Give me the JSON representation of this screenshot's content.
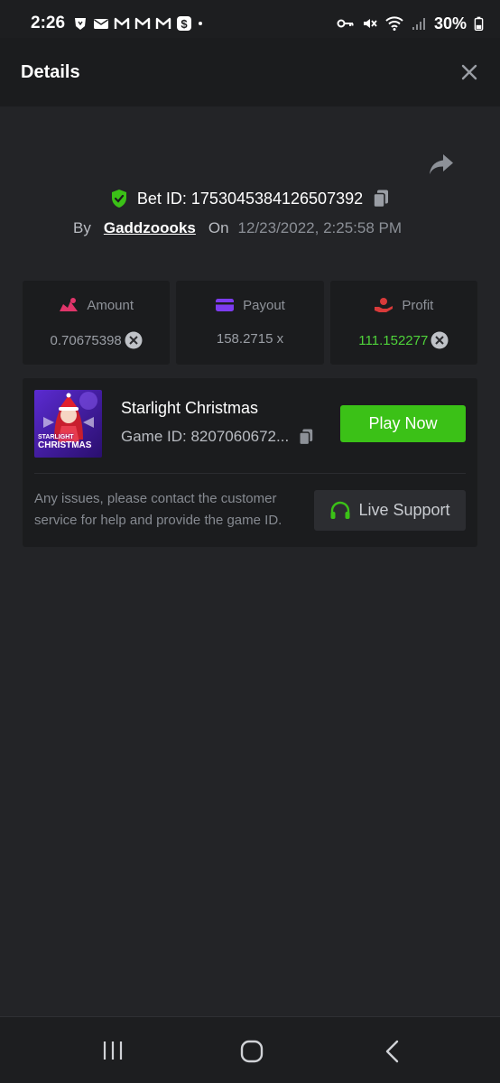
{
  "status_bar": {
    "time": "2:26",
    "battery": "30%"
  },
  "header": {
    "title": "Details"
  },
  "bet": {
    "bet_id_label": "Bet ID:",
    "bet_id": "1753045384126507392",
    "by_label": "By",
    "username": "Gaddzoooks",
    "on_label": "On",
    "date": "12/23/2022, 2:25:58 PM"
  },
  "stats": {
    "amount": {
      "label": "Amount",
      "value": "0.70675398"
    },
    "payout": {
      "label": "Payout",
      "value": "158.2715 x"
    },
    "profit": {
      "label": "Profit",
      "value": "111.152277"
    }
  },
  "game": {
    "name": "Starlight Christmas",
    "game_id": "Game ID: 8207060672...",
    "thumb_title_line1": "STARLIGHT",
    "thumb_title_line2": "CHRISTMAS",
    "play_label": "Play Now",
    "support_text": "Any issues, please contact the customer service for help and provide the game ID.",
    "support_label": "Live Support"
  },
  "colors": {
    "background": "#232427",
    "card": "#1b1c1e",
    "accent_green": "#3bc117",
    "profit_green": "#4fd33a",
    "amount_icon": "#e0356a",
    "payout_icon": "#7d3cf0",
    "profit_icon": "#d83a3a"
  },
  "icons": {
    "status_left": [
      "brave-icon",
      "mail-icon",
      "gmail-icon",
      "gmail-icon",
      "gmail-icon",
      "cashapp-icon",
      "dot-icon"
    ],
    "status_right": [
      "key-icon",
      "mute-icon",
      "wifi-icon",
      "signal-icon",
      "battery-icon"
    ],
    "close": "close-icon",
    "share": "share-icon",
    "verified": "shield-check-icon",
    "copy": "copy-icon",
    "amount": "bet-amount-icon",
    "payout": "card-icon",
    "profit": "profit-hand-icon",
    "coin": "coin-icon",
    "support": "headset-icon",
    "nav": [
      "recents-icon",
      "home-icon",
      "back-icon"
    ]
  }
}
